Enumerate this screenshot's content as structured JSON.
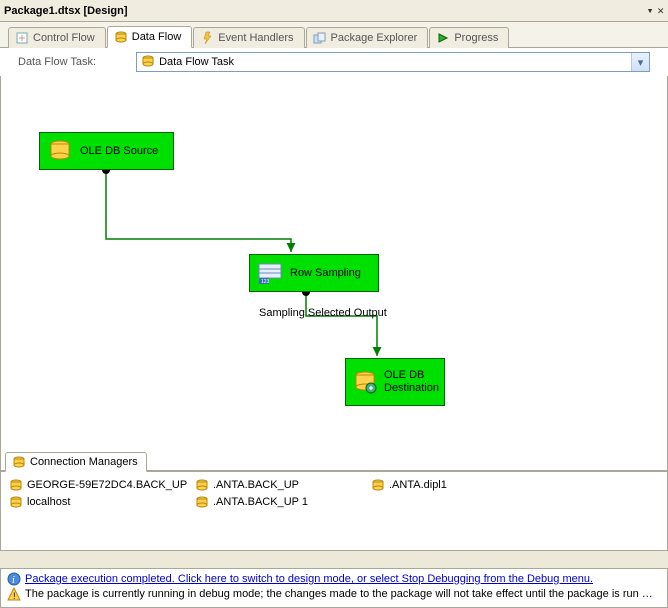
{
  "title": "Package1.dtsx [Design]",
  "tabs": [
    {
      "label": "Control Flow"
    },
    {
      "label": "Data Flow"
    },
    {
      "label": "Event Handlers"
    },
    {
      "label": "Package Explorer"
    },
    {
      "label": "Progress"
    }
  ],
  "task_label": "Data Flow Task:",
  "task_selected": "Data Flow Task",
  "nodes": {
    "source": "OLE DB Source",
    "sampling": "Row Sampling",
    "dest_line1": "OLE DB",
    "dest_line2": "Destination"
  },
  "connector_label": "Sampling Selected Output",
  "conn_mgr_title": "Connection Managers",
  "connections": [
    "GEORGE-59E72DC4.BACK_UP",
    ".ANTA.BACK_UP",
    ".ANTA.dipl1",
    "localhost",
    ".ANTA.BACK_UP 1"
  ],
  "status": {
    "info": "Package execution completed. Click here to switch to design mode, or select Stop Debugging from the Debug menu.",
    "warn": "The package is currently running in debug mode; the changes made to the package will not take effect until the package is run ag..."
  }
}
